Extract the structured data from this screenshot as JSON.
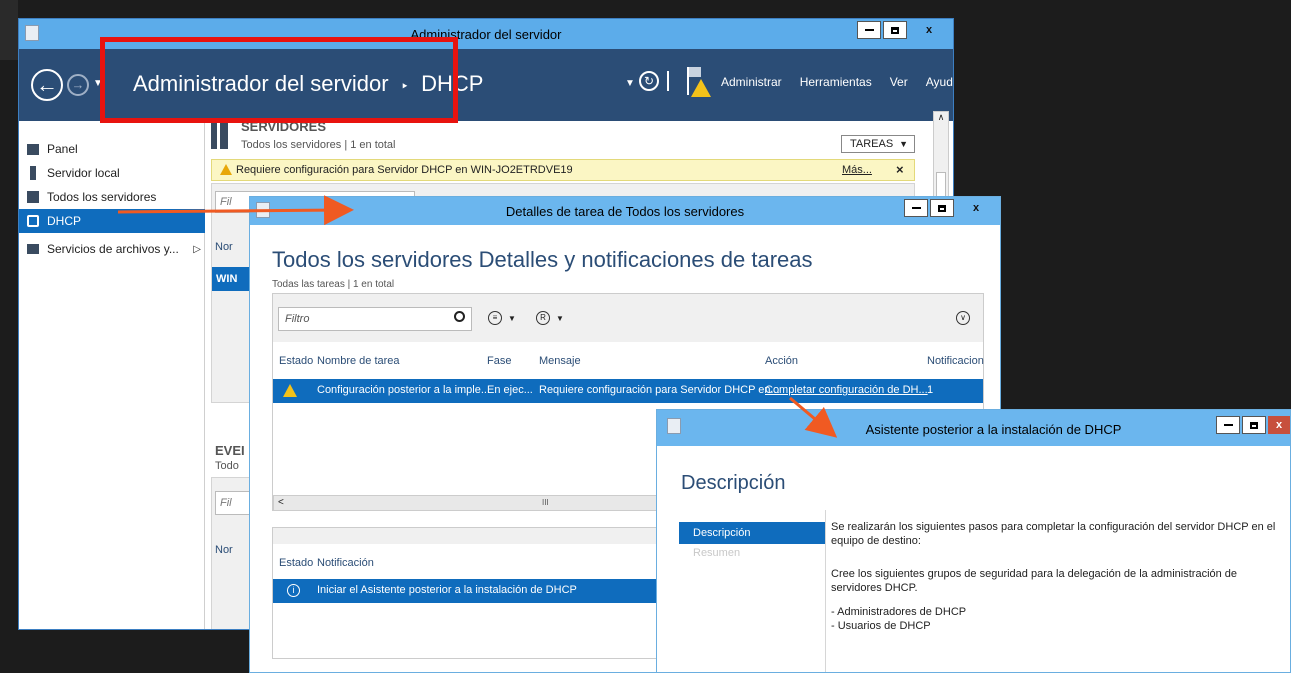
{
  "main_window": {
    "title": "Administrador del servidor",
    "close_glyph": "x",
    "breadcrumb": {
      "root": "Administrador del servidor",
      "separator": "‣",
      "current": "DHCP"
    },
    "menu": {
      "manage": "Administrar",
      "tools": "Herramientas",
      "view": "Ver",
      "help": "Ayuda"
    },
    "sidebar": [
      {
        "label": "Panel",
        "icon": "dashboard-icon"
      },
      {
        "label": "Servidor local",
        "icon": "local-server-icon"
      },
      {
        "label": "Todos los servidores",
        "icon": "all-servers-icon"
      },
      {
        "label": "DHCP",
        "icon": "dhcp-icon",
        "selected": true
      },
      {
        "label": "Servicios de archivos y...",
        "icon": "file-services-icon",
        "arrow": "▷"
      }
    ],
    "servers": {
      "heading": "SERVIDORES",
      "sub": "Todos los servidores | 1 en total",
      "tasks_button": "TAREAS",
      "warning": "Requiere configuración para Servidor DHCP en WIN-JO2ETRDVE19",
      "more": "Más...",
      "close": "×",
      "filter_partial": "Fil",
      "col_partial": "Nor",
      "row_partial": "WIN"
    },
    "events": {
      "heading_partial": "EVEI",
      "sub_partial": "Todo",
      "filter_partial": "Fil",
      "col_partial": "Nor"
    }
  },
  "task_window": {
    "title": "Detalles de tarea de Todos los servidores",
    "close_glyph": "x",
    "heading": "Todos los servidores Detalles y notificaciones de tareas",
    "sub": "Todas las tareas | 1 en total",
    "filter_placeholder": "Filtro",
    "columns": [
      "Estado",
      "Nombre de tarea",
      "Fase",
      "Mensaje",
      "Acción",
      "Notificacion"
    ],
    "row": {
      "name": "Configuración posterior a la imple...",
      "phase": "En ejec...",
      "message": "Requiere configuración para Servidor DHCP en...",
      "action": "Completar configuración de DH...",
      "notifications": "1"
    },
    "scroll_left": "<",
    "scroll_thumb": "III",
    "notif_columns": [
      "Estado",
      "Notificación"
    ],
    "notif_row": "Iniciar el Asistente posterior a la instalación de DHCP"
  },
  "wizard": {
    "title": "Asistente posterior a la instalación de DHCP",
    "close_glyph": "x",
    "heading": "Descripción",
    "steps": [
      "Descripción",
      "Resumen"
    ],
    "p1": "Se realizarán los siguientes pasos para completar la configuración del servidor DHCP en el equipo de destino:",
    "p2": "Cree los siguientes grupos de seguridad para la delegación de la administración de servidores DHCP.",
    "groups": [
      "- Administradores de DHCP",
      "- Usuarios de DHCP"
    ]
  },
  "colors": {
    "accent": "#0f6cbd",
    "titlebar": "#5cacea",
    "highlight_box": "#e8130f",
    "arrow": "#f05a22",
    "warning_bg": "#fbf6c4"
  }
}
